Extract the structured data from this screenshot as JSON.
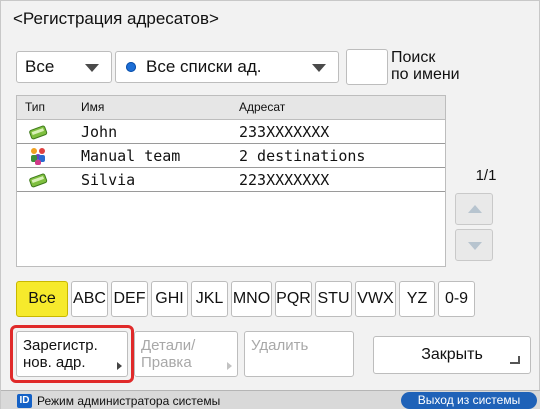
{
  "header": {
    "title": "<Регистрация адресатов>"
  },
  "filters": {
    "type_select": "Все",
    "list_select": "Все списки ад.",
    "search_by_name_line1": "Поиск",
    "search_by_name_line2": "по имени"
  },
  "table": {
    "columns": [
      "Тип",
      "Имя",
      "Адресат"
    ],
    "rows": [
      {
        "type_icon": "address-book-entry-icon",
        "name": "John",
        "destination": "233XXXXXXX"
      },
      {
        "type_icon": "group-icon",
        "name": "Manual team",
        "destination": "2 destinations"
      },
      {
        "type_icon": "address-book-entry-icon",
        "name": "Silvia",
        "destination": "223XXXXXXX"
      }
    ]
  },
  "pager": {
    "text": "1/1"
  },
  "index_tabs": [
    "Все",
    "ABC",
    "DEF",
    "GHI",
    "JKL",
    "MNO",
    "PQR",
    "STU",
    "VWX",
    "YZ",
    "0-9"
  ],
  "buttons": {
    "register_line1": "Зарегистр.",
    "register_line2": "нов. адр.",
    "details_line1": "Детали/",
    "details_line2": "Правка",
    "delete": "Удалить",
    "close": "Закрыть"
  },
  "status": {
    "badge": "ID",
    "mode": "Режим администратора системы",
    "logout": "Выход из системы"
  },
  "colors": {
    "active_tab": "#f6ea2c",
    "highlight": "#e02a2a",
    "logout": "#1f62b8"
  }
}
